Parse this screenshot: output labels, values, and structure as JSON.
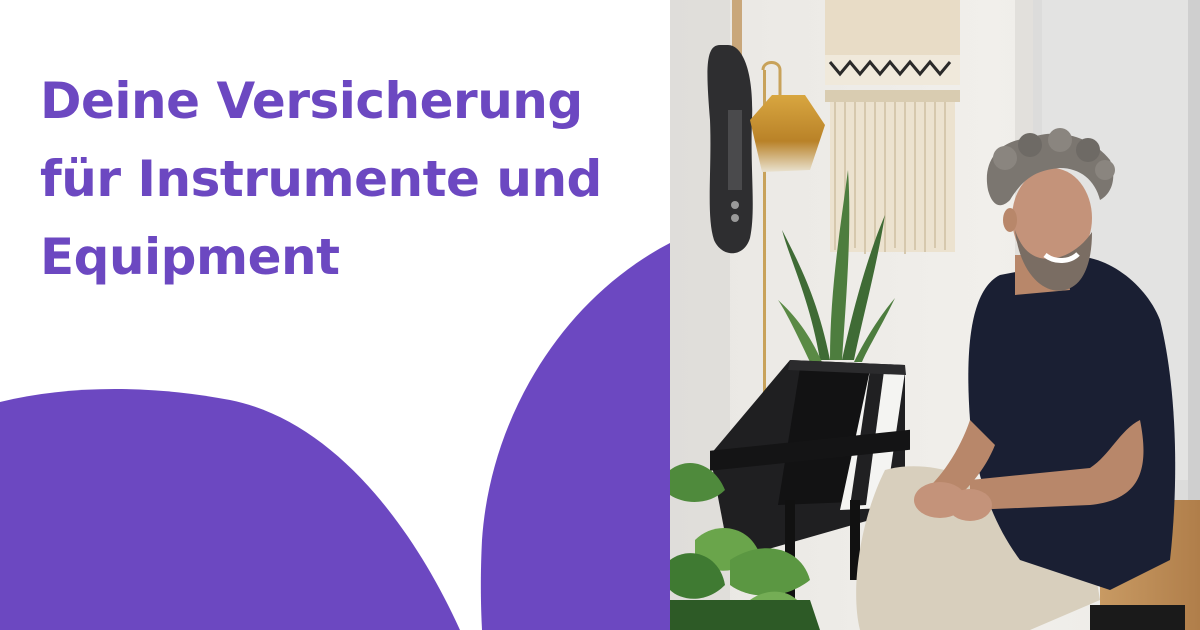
{
  "headline": {
    "line1": "Deine Versicherung",
    "line2": "für Instrumente und",
    "line3": "Equipment"
  },
  "colors": {
    "brand": "#6c48c1",
    "background": "#ffffff"
  },
  "photo": {
    "subject": "smiling man seated at a digital piano with guitar and plants"
  }
}
